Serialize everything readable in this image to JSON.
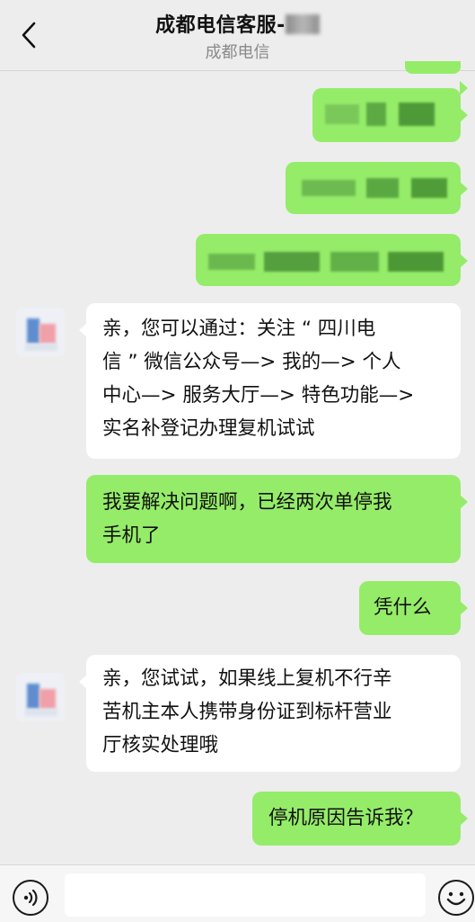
{
  "header": {
    "title": "成都电信客服-",
    "subtitle": "成都电信"
  },
  "messages": [
    {
      "side": "right",
      "text": "",
      "redacted": true
    },
    {
      "side": "right",
      "text": "",
      "redacted": true
    },
    {
      "side": "right",
      "text": "",
      "redacted": true
    },
    {
      "side": "right",
      "text": "",
      "redacted": true
    },
    {
      "side": "left",
      "lines": [
        "亲，您可以通过：关注 “ 四川电",
        "信 ” 微信公众号—> 我的—> 个人",
        "中心—> 服务大厅—> 特色功能—>",
        "实名补登记办理复机试试"
      ]
    },
    {
      "side": "right",
      "lines": [
        "我要解决问题啊，已经两次单停我",
        "手机了"
      ]
    },
    {
      "side": "right",
      "lines": [
        "凭什么"
      ]
    },
    {
      "side": "left",
      "lines": [
        "亲，您试试，如果线上复机不行辛",
        "苦机主本人携带身份证到标杆营业",
        "厅核实处理哦"
      ]
    },
    {
      "side": "right",
      "lines": [
        "停机原因告诉我？"
      ]
    }
  ],
  "input": {
    "value": "",
    "placeholder": ""
  },
  "icons": {
    "back": "chevron-left-icon",
    "voice": "voice-icon",
    "emoji": "emoji-icon"
  },
  "colors": {
    "sent_bubble": "#95ec69",
    "received_bubble": "#ffffff",
    "background": "#ededed"
  }
}
